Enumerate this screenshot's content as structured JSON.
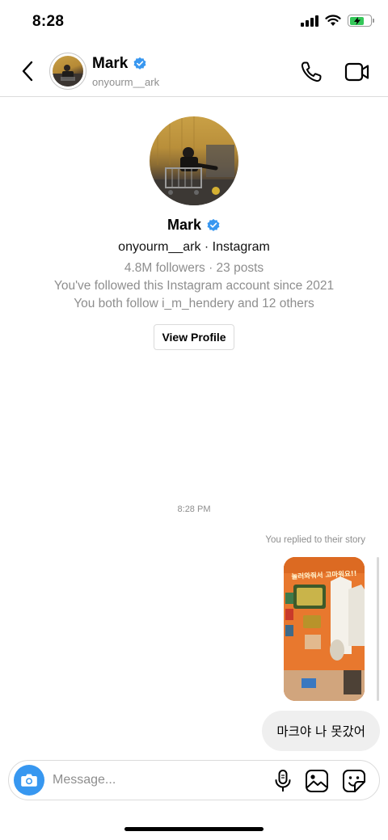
{
  "status_bar": {
    "time": "8:28"
  },
  "header": {
    "name": "Mark",
    "username": "onyourm__ark",
    "back_icon": "chevron-left-icon",
    "call_icon": "phone-icon",
    "video_icon": "video-camera-icon"
  },
  "profile": {
    "name": "Mark",
    "subtitle": "onyourm__ark · Instagram",
    "stats": "4.8M followers · 23 posts",
    "followed_since": "You've followed this Instagram account since 2021",
    "mutuals": "You both follow i_m_hendery and 12 others",
    "view_profile_label": "View Profile"
  },
  "conversation": {
    "timestamp": "8:28 PM",
    "story_reply_label": "You replied to their story",
    "story_text": "놀러와줘서 고마워요!!",
    "message": "마크야 나 못갔어"
  },
  "composer": {
    "placeholder": "Message...",
    "camera_icon": "camera-icon",
    "mic_icon": "microphone-icon",
    "gallery_icon": "image-icon",
    "sticker_icon": "sticker-icon"
  },
  "colors": {
    "accent_blue": "#3797f0",
    "verified_blue": "#3897f0",
    "muted_text": "#8e8e8e",
    "bubble_bg": "#efefef",
    "story_orange": "#e8782e"
  }
}
